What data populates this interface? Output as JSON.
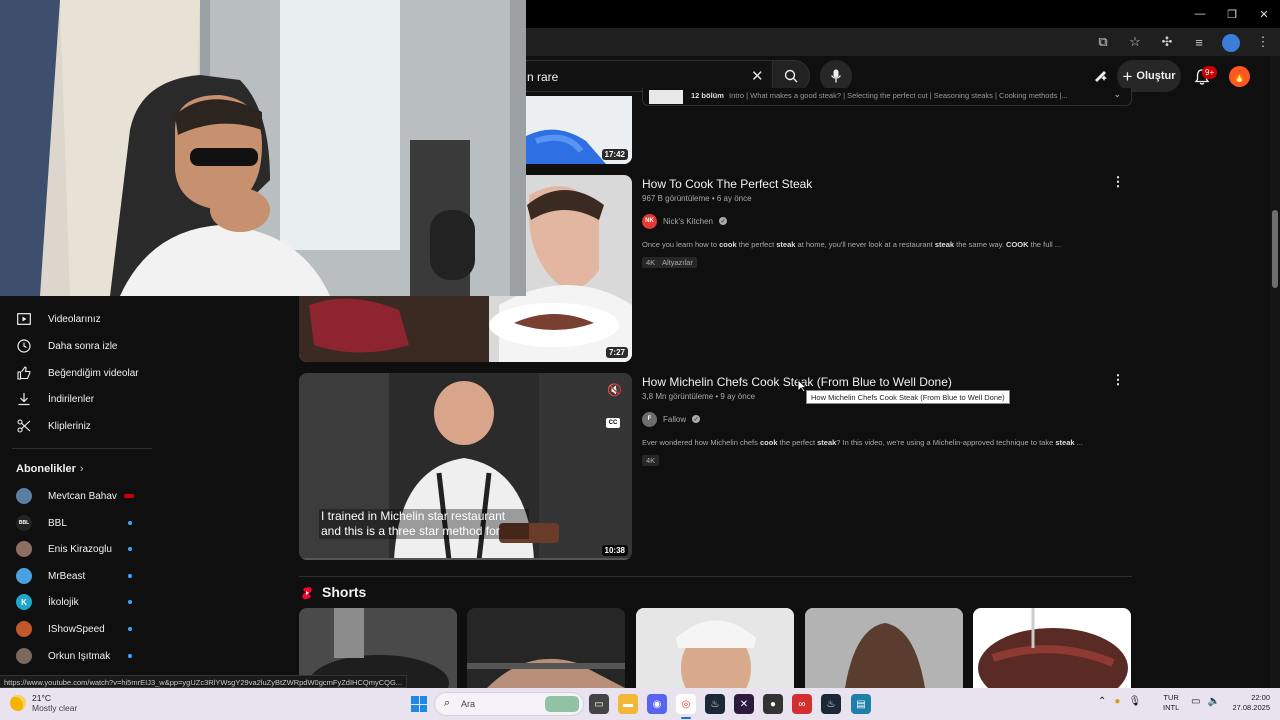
{
  "window": {
    "minimize": "—",
    "restore": "❐",
    "close": "✕"
  },
  "header": {
    "search_value": "n rare",
    "create_label": "Oluştur",
    "notif_count": "9+"
  },
  "sidebar": {
    "items": [
      {
        "label": "Videolarınız",
        "icon": "play-square-icon"
      },
      {
        "label": "Daha sonra izle",
        "icon": "clock-icon"
      },
      {
        "label": "Beğendiğim videolar",
        "icon": "thumbs-up-icon"
      },
      {
        "label": "İndirilenler",
        "icon": "download-icon"
      },
      {
        "label": "Klipleriniz",
        "icon": "scissors-icon"
      }
    ],
    "subscriptions_heading": "Abonelikler",
    "subscriptions": [
      {
        "name": "Mevtcan Bahav",
        "color": "#5b7fa3",
        "live": true
      },
      {
        "name": "BBL",
        "color": "#222222",
        "initials": "BBL"
      },
      {
        "name": "Enis Kirazoglu",
        "color": "#8d6e63"
      },
      {
        "name": "MrBeast",
        "color": "#4aa3df"
      },
      {
        "name": "İkolojik",
        "color": "#1ea7c8",
        "initials": "K"
      },
      {
        "name": "IShowSpeed",
        "color": "#c0572d"
      },
      {
        "name": "Orkun Işıtmak",
        "color": "#7a6a5d"
      }
    ]
  },
  "prev_result": {
    "duration": "17:42",
    "chapters_label": "12 bölüm",
    "chapters_text": "Intro | What makes a good steak? | Selecting the perfect cut | Seasoning steaks | Cooking methods |..."
  },
  "results": [
    {
      "title": "How To Cook The Perfect Steak",
      "meta": "967 B görüntüleme • 6 ay önce",
      "channel": "Nick's Kitchen",
      "channel_initials": "NK",
      "channel_color": "#e53935",
      "desc_parts": [
        "Once you learn how to ",
        "cook",
        " the perfect ",
        "steak",
        " at home, you'll never look at a restaurant ",
        "steak",
        " the same way. ",
        "COOK",
        " the full ..."
      ],
      "badges": [
        "4K",
        "Altyazılar"
      ],
      "duration": "7:27"
    },
    {
      "title": "How Michelin Chefs Cook Steak (From Blue to Well Done)",
      "meta": "3,8 Mn görüntüleme • 9 ay önce",
      "channel": "Fallow",
      "channel_initials": "F",
      "channel_color": "#6d6d6d",
      "desc_parts": [
        "Ever wondered how Michelin chefs ",
        "cook",
        " the perfect ",
        "steak",
        "? In this video, we're using a Michelin-approved technique to take ",
        "steak",
        " ..."
      ],
      "badges": [
        "4K"
      ],
      "duration": "10:38",
      "caption": "I trained in Michelin star restaurant and this is a three star method for",
      "tooltip": "How Michelin Chefs Cook Steak (From Blue to Well Done)"
    }
  ],
  "shorts": {
    "heading": "Shorts"
  },
  "status_url": "https://www.youtube.com/watch?v=hi5mrEIJ3_w&pp=ygUZc3RlYWsgY29va2luZyBtZWRpdW0gcmFyZdIHCQmyCQG...",
  "taskbar": {
    "weather_temp": "21°C",
    "weather_cond": "Mostly clear",
    "search_placeholder": "Ara",
    "lang_top": "TUR",
    "lang_bottom": "INTL",
    "time": "22:00",
    "date": "27.08.2025"
  }
}
